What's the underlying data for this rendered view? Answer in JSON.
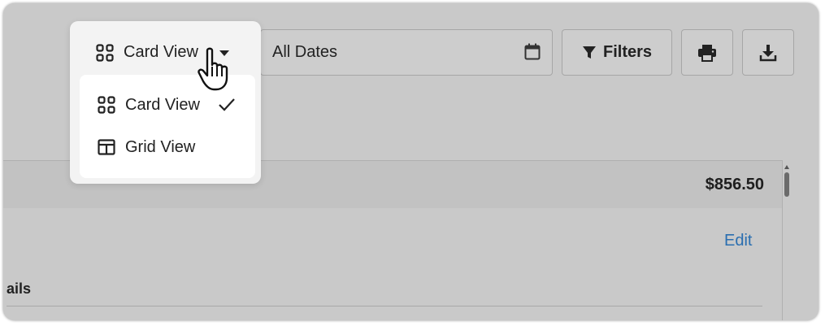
{
  "view_switcher": {
    "selected_label": "Card View",
    "options": [
      {
        "label": "Card View",
        "icon": "card-view-icon",
        "checked": true
      },
      {
        "label": "Grid View",
        "icon": "grid-view-icon",
        "checked": false
      }
    ]
  },
  "date_filter": {
    "value": "All Dates",
    "icon": "calendar-icon"
  },
  "toolbar": {
    "filters_label": "Filters",
    "print_icon": "print-icon",
    "download_icon": "download-icon"
  },
  "card": {
    "total": "$856.50",
    "edit_label": "Edit",
    "section_label": "ails"
  },
  "colors": {
    "link": "#2a6eb0",
    "overlay": "#c9c9c9",
    "menu_bg": "#ffffff"
  }
}
